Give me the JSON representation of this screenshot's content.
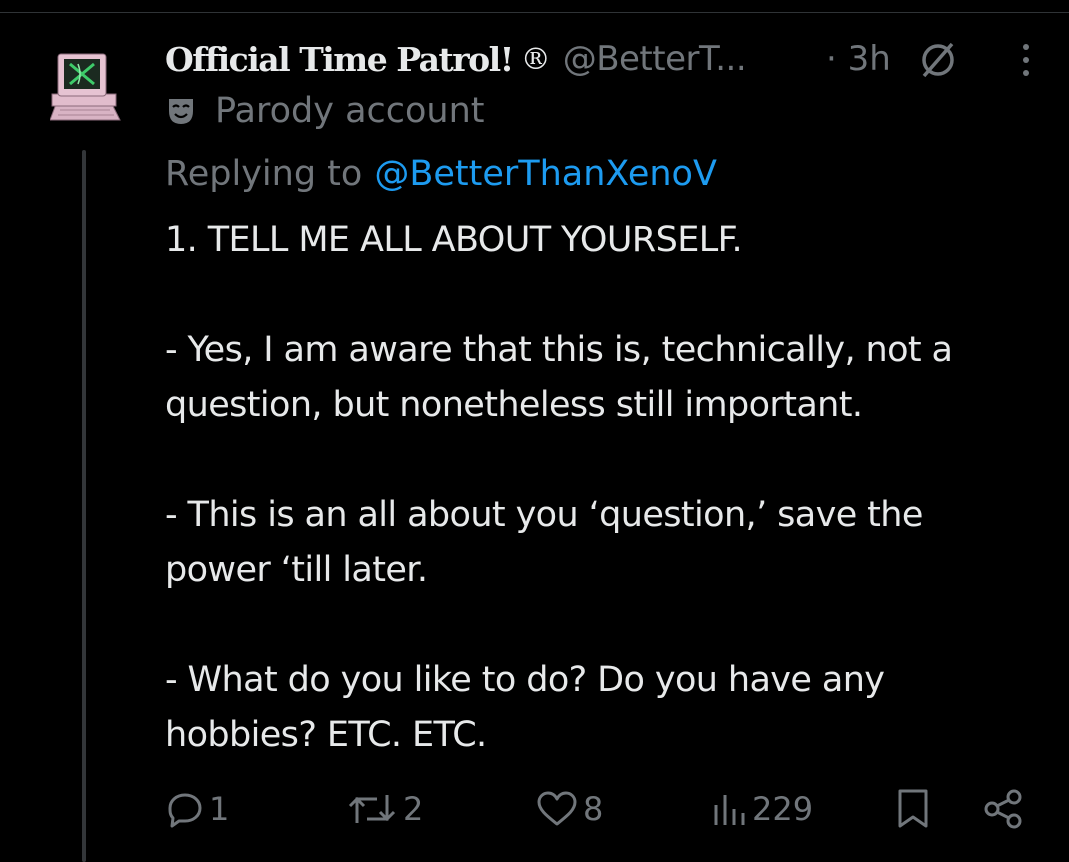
{
  "post": {
    "display_name": "Official Time Patrol!",
    "registered_mark": "®",
    "handle": "@BetterT...",
    "time": "· 3h",
    "parody_label": "Parody account",
    "replying_prefix": "Replying to",
    "replying_handle": "@BetterThanXenoV",
    "text_lines": [
      "1. TELL ME ALL ABOUT YOURSELF.",
      "",
      "- Yes, I am aware that this is, technically, not a",
      "question, but nonetheless still important.",
      "",
      "- This is an all about you ‘question,’ save the",
      "power ‘till later.",
      "",
      "- What do you like to do? Do you have any",
      "hobbies? ETC. ETC."
    ]
  },
  "actions": {
    "replies": "1",
    "reposts": "2",
    "likes": "8",
    "views": "229"
  },
  "icons": {
    "avatar": "retro-computer-avatar",
    "no_sign": "no-sign-icon",
    "more": "more-vertical-icon",
    "parody": "theater-mask-icon",
    "reply": "reply-icon",
    "repost": "repost-icon",
    "like": "heart-icon",
    "views": "views-icon",
    "bookmark": "bookmark-icon",
    "share": "share-icon"
  },
  "colors": {
    "background": "#000000",
    "text": "#e7e9ea",
    "secondary": "#71767b",
    "link": "#1d9bf0",
    "thread_line": "#333639"
  }
}
